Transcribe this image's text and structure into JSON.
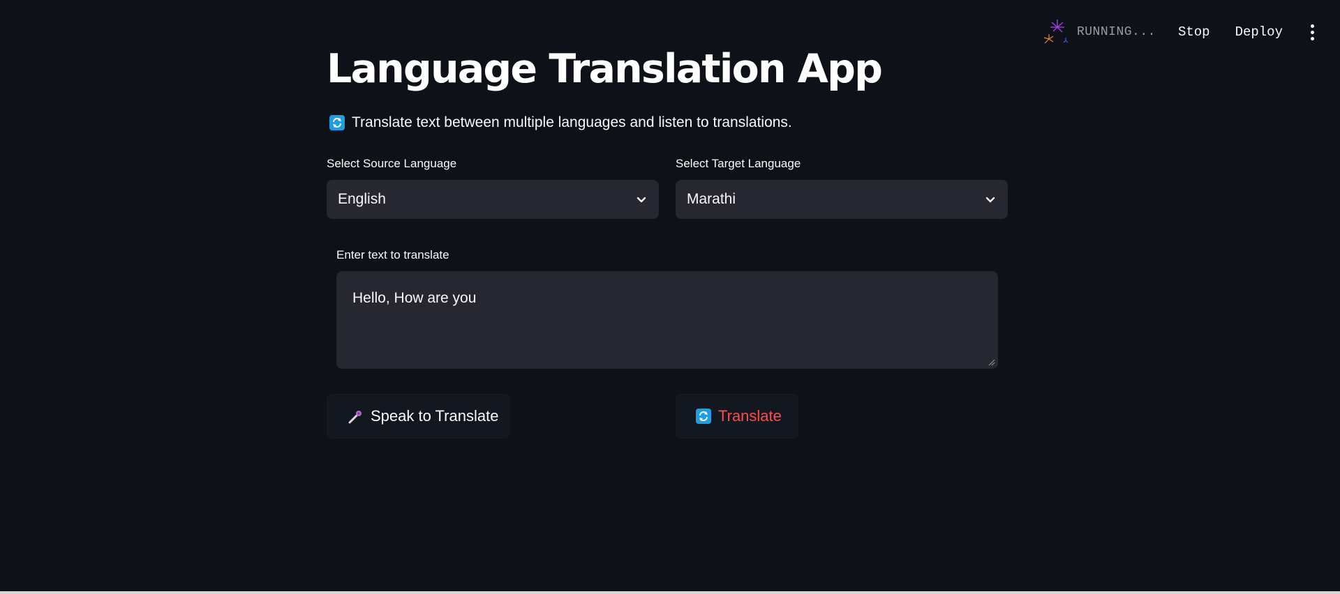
{
  "toolbar": {
    "status_text": "RUNNING...",
    "stop_label": "Stop",
    "deploy_label": "Deploy"
  },
  "main": {
    "title": "Language Translation App",
    "subtitle": "Translate text between multiple languages and listen to translations."
  },
  "source_language": {
    "label": "Select Source Language",
    "selected": "English"
  },
  "target_language": {
    "label": "Select Target Language",
    "selected": "Marathi"
  },
  "text_input": {
    "label": "Enter text to translate",
    "value": "Hello, How are you"
  },
  "buttons": {
    "speak_label": "Speak to Translate",
    "translate_label": "Translate"
  },
  "icons": {
    "status": "fireworks-icon",
    "subtitle": "arrows-cycle-icon",
    "select": "chevron-down-icon",
    "speak": "microphone-icon",
    "translate": "arrows-cycle-icon",
    "menu": "kebab-menu-icon"
  },
  "colors": {
    "background": "#0e1117",
    "input_background": "#262730",
    "accent_red": "#ff4b4b",
    "emoji_blue": "#1f9de0"
  }
}
